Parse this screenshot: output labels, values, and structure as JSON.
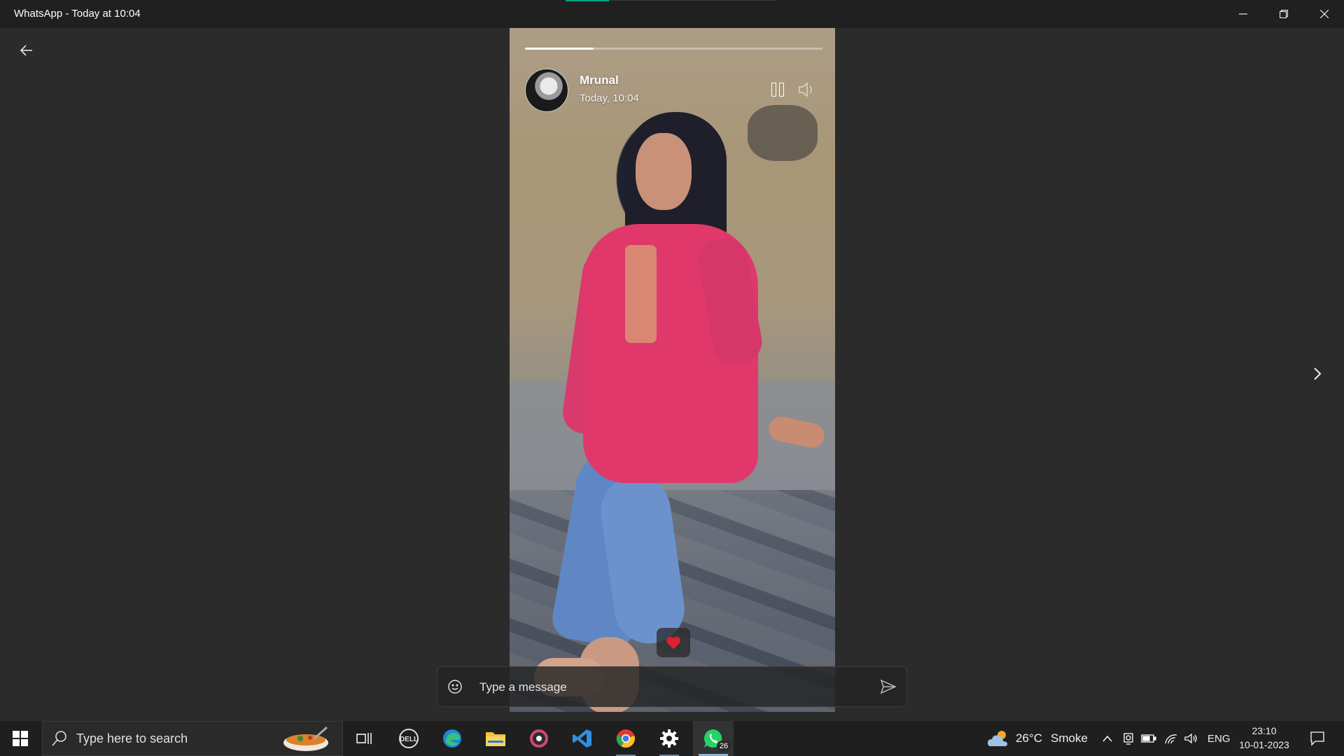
{
  "window": {
    "title": "WhatsApp - Today at 10:04",
    "controls": [
      "minimize-icon",
      "restore-icon",
      "close-icon"
    ]
  },
  "viewer": {
    "back_icon": "arrow-left-icon",
    "next_icon": "chevron-right-icon",
    "story": {
      "progress": 0.23,
      "sender_name": "Mrunal",
      "time": "Today, 10:04",
      "pause_icon": "pause-icon",
      "volume_icon": "volume-icon",
      "reaction_icon": "heart-icon"
    },
    "reply": {
      "placeholder": "Type a message",
      "emoji_icon": "emoji-icon",
      "send_icon": "send-icon"
    }
  },
  "taskbar": {
    "search_placeholder": "Type here to search",
    "apps": [
      {
        "name": "task-view"
      },
      {
        "name": "dell"
      },
      {
        "name": "edge"
      },
      {
        "name": "file-explorer"
      },
      {
        "name": "media"
      },
      {
        "name": "vs-code"
      },
      {
        "name": "chrome"
      },
      {
        "name": "settings"
      },
      {
        "name": "whatsapp",
        "badge": "26",
        "active": true
      }
    ],
    "weather": {
      "temp": "26°C",
      "condition": "Smoke"
    },
    "language": "ENG",
    "time": "23:10",
    "date": "10-01-2023"
  },
  "colors": {
    "accent": "#00a884",
    "titlebar": "#202020",
    "background": "#2b2b2b",
    "taskbar": "#1f1f1f"
  }
}
